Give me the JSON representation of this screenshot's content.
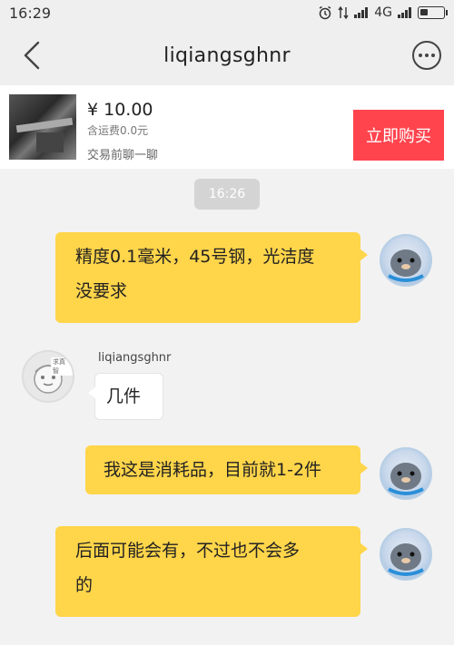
{
  "status": {
    "time": "16:29",
    "network": "4G"
  },
  "nav": {
    "title": "liqiangsghnr"
  },
  "product": {
    "price": "¥ 10.00",
    "shipping": "含运费0.0元",
    "chat_hint": "交易前聊一聊",
    "buy_label": "立即购买"
  },
  "chat": {
    "timestamp": "16:26",
    "other_sender": "liqiangsghnr",
    "other_avatar_tag": "求真智",
    "messages": [
      {
        "from": "me",
        "line1": "精度0.1毫米，45号钢，光洁度",
        "line2": "没要求"
      },
      {
        "from": "them",
        "line1": "几件"
      },
      {
        "from": "me",
        "line1": "我这是消耗品，目前就1-2件"
      },
      {
        "from": "me",
        "line1": "后面可能会有，不过也不会多",
        "line2": "的"
      }
    ]
  },
  "colors": {
    "buy": "#ff444e",
    "my_bubble": "#ffd54a",
    "background": "#f2f2f2"
  }
}
